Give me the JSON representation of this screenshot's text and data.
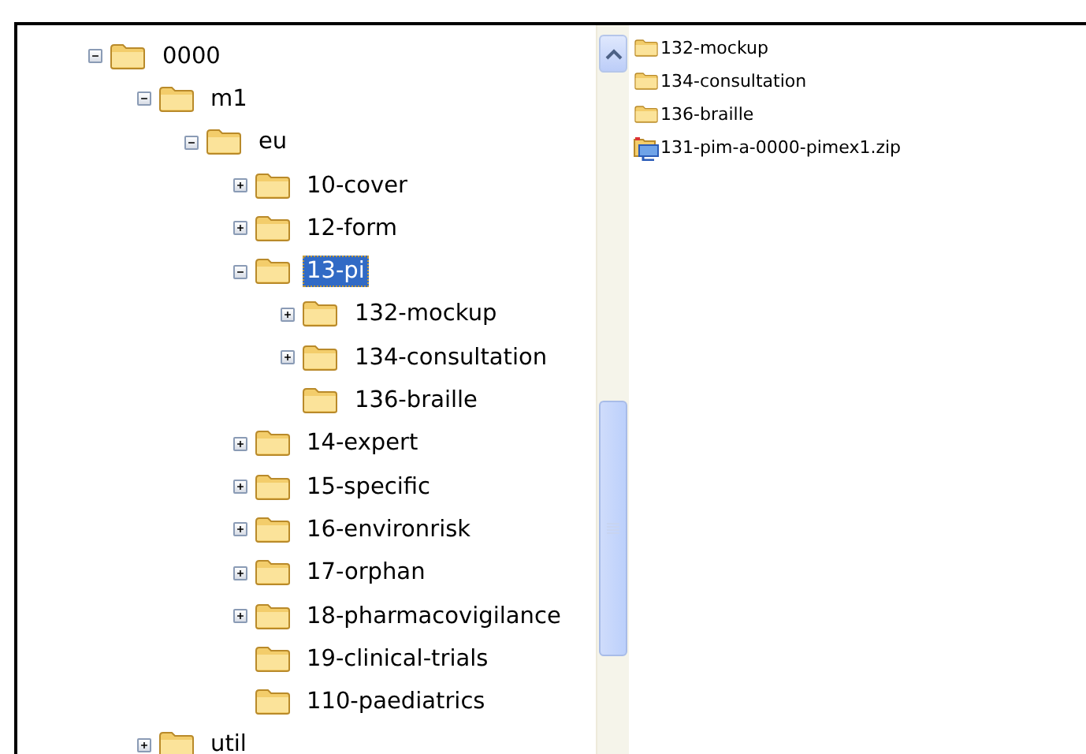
{
  "tree": [
    {
      "label": "0000",
      "has_children": true,
      "expanded": true,
      "selected": false,
      "children": [
        {
          "label": "m1",
          "has_children": true,
          "expanded": true,
          "selected": false,
          "children": [
            {
              "label": "eu",
              "has_children": true,
              "expanded": true,
              "selected": false,
              "children": [
                {
                  "label": "10-cover",
                  "has_children": true,
                  "expanded": false,
                  "selected": false
                },
                {
                  "label": "12-form",
                  "has_children": true,
                  "expanded": false,
                  "selected": false
                },
                {
                  "label": "13-pi",
                  "has_children": true,
                  "expanded": true,
                  "selected": true,
                  "children": [
                    {
                      "label": "132-mockup",
                      "has_children": true,
                      "expanded": false,
                      "selected": false
                    },
                    {
                      "label": "134-consultation",
                      "has_children": true,
                      "expanded": false,
                      "selected": false
                    },
                    {
                      "label": "136-braille",
                      "has_children": false,
                      "expanded": false,
                      "selected": false
                    }
                  ]
                },
                {
                  "label": "14-expert",
                  "has_children": true,
                  "expanded": false,
                  "selected": false
                },
                {
                  "label": "15-specific",
                  "has_children": true,
                  "expanded": false,
                  "selected": false
                },
                {
                  "label": "16-environrisk",
                  "has_children": true,
                  "expanded": false,
                  "selected": false
                },
                {
                  "label": "17-orphan",
                  "has_children": true,
                  "expanded": false,
                  "selected": false
                },
                {
                  "label": "18-pharmacovigilance",
                  "has_children": true,
                  "expanded": false,
                  "selected": false
                },
                {
                  "label": "19-clinical-trials",
                  "has_children": false,
                  "expanded": false,
                  "selected": false
                },
                {
                  "label": "110-paediatrics",
                  "has_children": false,
                  "expanded": false,
                  "selected": false
                }
              ]
            }
          ]
        },
        {
          "label": "util",
          "has_children": true,
          "expanded": false,
          "selected": false
        }
      ]
    }
  ],
  "files": [
    {
      "kind": "folder",
      "name": "132-mockup"
    },
    {
      "kind": "folder",
      "name": "134-consultation"
    },
    {
      "kind": "folder",
      "name": "136-braille"
    },
    {
      "kind": "archive",
      "name": "131-pim-a-0000-pimex1.zip"
    }
  ]
}
